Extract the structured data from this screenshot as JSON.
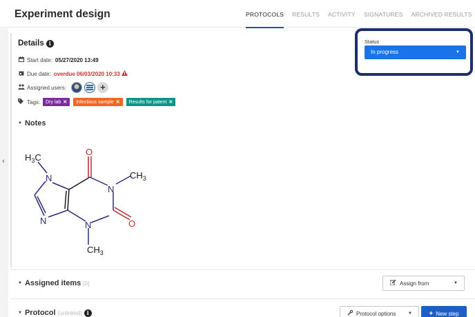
{
  "header": {
    "title": "Experiment design",
    "tabs": [
      {
        "label": "PROTOCOLS",
        "active": true
      },
      {
        "label": "RESULTS",
        "active": false
      },
      {
        "label": "ACTIVITY",
        "active": false
      },
      {
        "label": "SIGNATURES",
        "active": false
      },
      {
        "label": "ARCHIVED RESULTS",
        "active": false
      }
    ]
  },
  "details": {
    "heading": "Details",
    "info_icon": "i",
    "start_date_label": "Start date:",
    "start_date_value": "05/27/2020 13:49",
    "due_date_label": "Due date:",
    "due_date_value": "overdue 06/03/2020 10:33",
    "assigned_users_label": "Assigned users:",
    "add_user_glyph": "+",
    "tags_label": "Tags:",
    "tags": [
      {
        "label": "Dry lab",
        "color": "#7b2d9b"
      },
      {
        "label": "Infectious sample",
        "color": "#f26522"
      },
      {
        "label": "Results for patent",
        "color": "#109488"
      }
    ],
    "tag_remove_glyph": "✕"
  },
  "status": {
    "label": "Status",
    "value": "In progress",
    "highlight_color": "#1b2f6b",
    "select_color": "#1a73e8"
  },
  "notes": {
    "heading": "Notes",
    "molecule_labels": {
      "h3c": "H",
      "h3c_sub": "3",
      "h3c_c": "C",
      "ch3_right": "CH",
      "ch3_right_sub": "3",
      "ch3_bottom": "CH",
      "ch3_bottom_sub": "3",
      "n1": "N",
      "n2": "N",
      "n3": "N",
      "n4": "N",
      "o1": "O",
      "o2": "O"
    }
  },
  "assigned_items": {
    "heading": "Assigned items",
    "count": "[0]",
    "assign_from_label": "Assign from"
  },
  "protocol": {
    "heading": "Protocol",
    "sub": "(unlinked)",
    "options_label": "Protocol options",
    "new_step_label": "New step"
  },
  "icons": {
    "collapse": "‹",
    "caret": "▼",
    "section_caret": "▼"
  }
}
